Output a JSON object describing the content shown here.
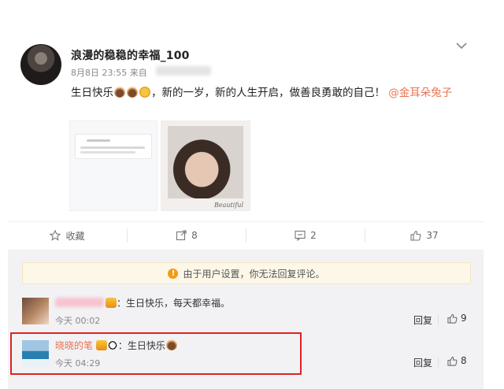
{
  "post": {
    "username": "浪漫的稳稳的幸福_100",
    "date": "8月8日 23:55",
    "source_prefix": "来自",
    "text_before": "生日快乐",
    "text_after": "，新的一岁，新的人生开启，做善良勇敢的自己！",
    "mention": "@金耳朵兔子",
    "image_signature": "Beautiful"
  },
  "actions": {
    "favorite_label": "收藏",
    "repost_count": "8",
    "comment_count": "2",
    "like_count": "37"
  },
  "notice": {
    "icon": "!",
    "text": "由于用户设置，你无法回复评论。"
  },
  "comments": [
    {
      "text": "：生日快乐，每天都幸福。",
      "time": "今天 00:02",
      "reply_label": "回复",
      "likes": "9"
    },
    {
      "nickname": "晓晓的笔",
      "text": "：生日快乐",
      "time": "今天 04:29",
      "reply_label": "回复",
      "likes": "8"
    }
  ],
  "colors": {
    "accent": "#eb7350",
    "highlight_border": "#e02020",
    "notice_bg": "#fdf7e8"
  },
  "icons": [
    "chevron-down-icon",
    "star-icon",
    "repost-icon",
    "comment-icon",
    "thumb-up-icon",
    "warning-icon"
  ]
}
